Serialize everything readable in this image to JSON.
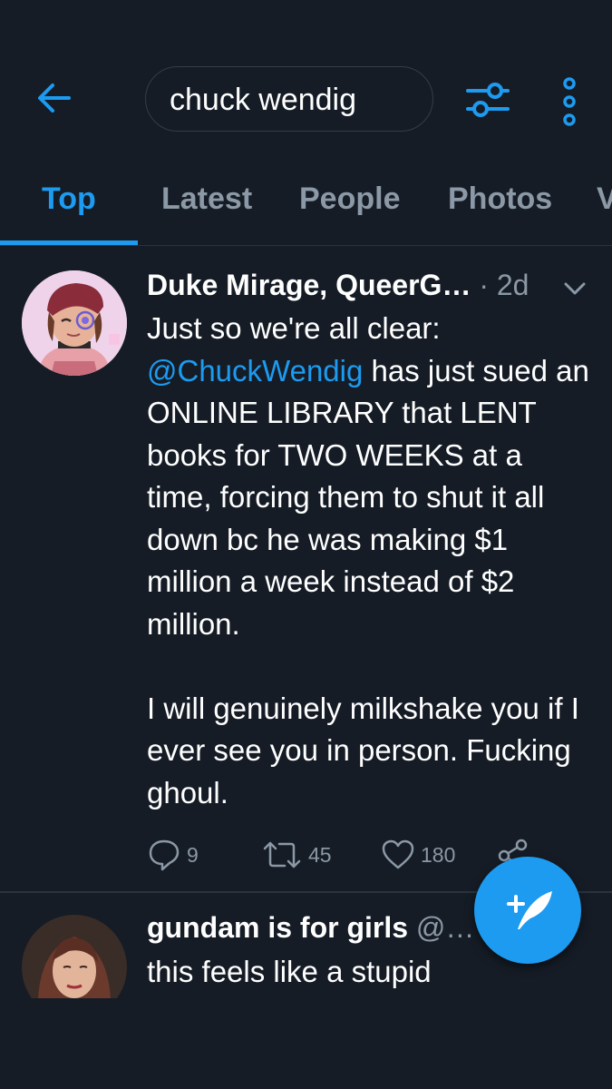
{
  "search": {
    "query": "chuck wendig"
  },
  "tabs": [
    {
      "label": "Top"
    },
    {
      "label": "Latest"
    },
    {
      "label": "People"
    },
    {
      "label": "Photos"
    },
    {
      "label": "V"
    }
  ],
  "tweets": [
    {
      "name": "Duke Mirage, QueerG…",
      "time": "· 2d",
      "text_prefix": "Just so we're all clear:\n",
      "mention": "@ChuckWendig",
      "text_suffix": " has just sued an ONLINE LIBRARY that LENT books for TWO WEEKS at a time, forcing them to shut it all down bc he was making $1 million a week instead of $2 million.\n\nI will genuinely milkshake you if I ever see you in person. Fucking ghoul.",
      "replies": "9",
      "retweets": "45",
      "likes": "180"
    },
    {
      "name": "gundam is for girls",
      "handle": "@…",
      "text": "this feels like a stupid"
    }
  ],
  "colors": {
    "accent": "#1d9bf0",
    "background": "#151c26",
    "muted": "#8b98a5"
  }
}
